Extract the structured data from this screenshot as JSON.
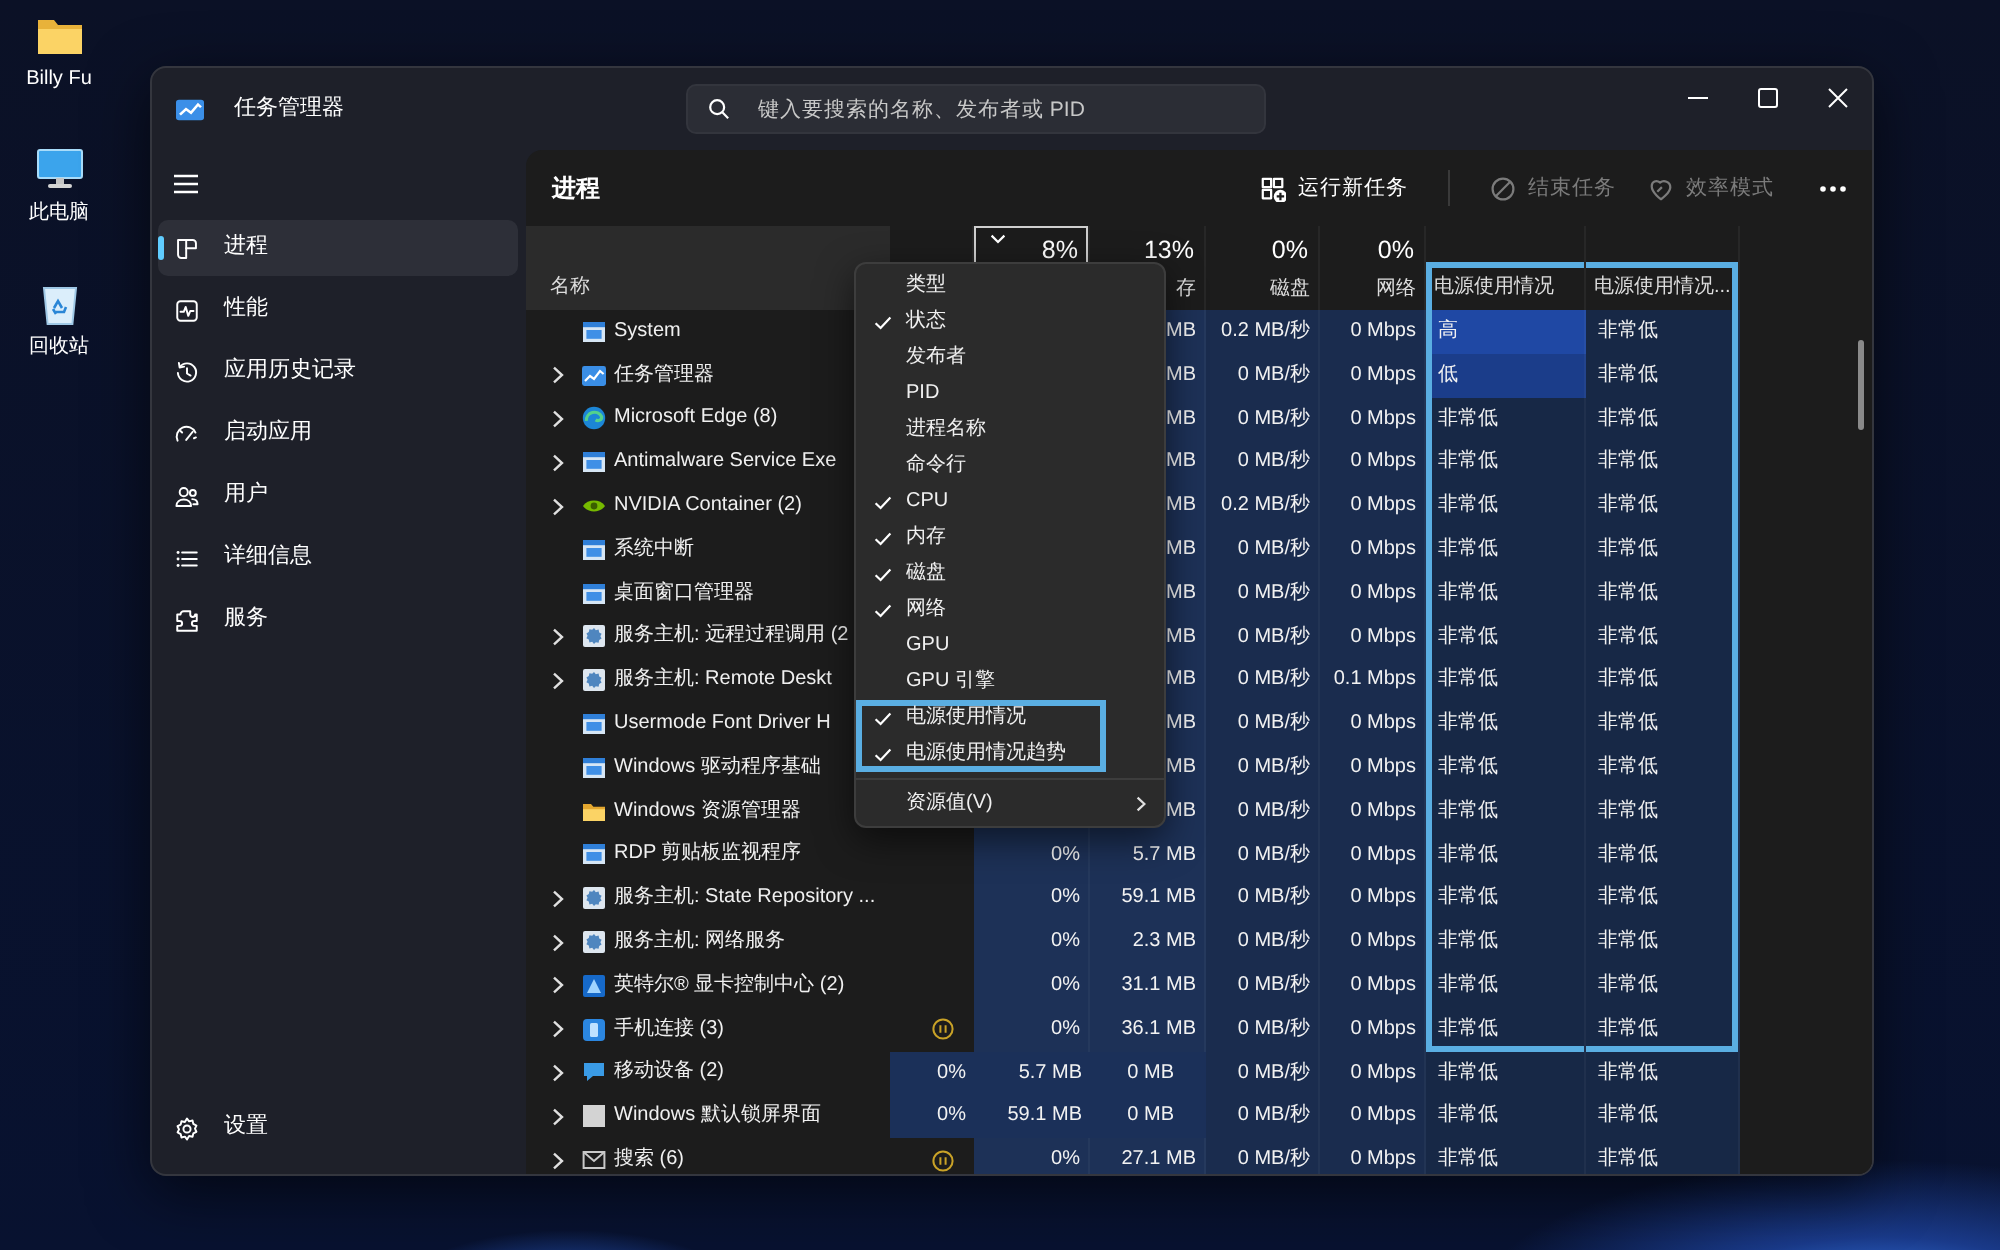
{
  "desktop": {
    "icons": [
      {
        "kind": "folder",
        "label": "Billy Fu"
      },
      {
        "kind": "computer",
        "label": "此电脑"
      },
      {
        "kind": "recycle",
        "label": "回收站"
      }
    ]
  },
  "window": {
    "title": "任务管理器",
    "search": {
      "placeholder": "键入要搜索的名称、发布者或 PID"
    }
  },
  "sidebar": {
    "items": [
      {
        "kind": "processes",
        "label": "进程",
        "selected": true
      },
      {
        "kind": "performance",
        "label": "性能",
        "selected": false
      },
      {
        "kind": "history",
        "label": "应用历史记录",
        "selected": false
      },
      {
        "kind": "startup",
        "label": "启动应用",
        "selected": false
      },
      {
        "kind": "users",
        "label": "用户",
        "selected": false
      },
      {
        "kind": "details",
        "label": "详细信息",
        "selected": false
      },
      {
        "kind": "services",
        "label": "服务",
        "selected": false
      }
    ],
    "footer": {
      "kind": "settings",
      "label": "设置",
      "selected": false
    }
  },
  "page": {
    "title": "进程",
    "actions": [
      {
        "kind": "run",
        "label": "运行新任务",
        "disabled": false
      },
      {
        "kind": "end",
        "label": "结束任务",
        "disabled": true
      },
      {
        "kind": "eco",
        "label": "效率模式",
        "disabled": true
      }
    ]
  },
  "table": {
    "columns": [
      {
        "kind": "name",
        "label": "名称"
      },
      {
        "kind": "status"
      },
      {
        "kind": "metric",
        "percent": "8%",
        "sorted": true
      },
      {
        "kind": "metric",
        "percent": "13%",
        "label": "存",
        "sorted": false
      },
      {
        "kind": "metric",
        "percent": "0%",
        "label": "磁盘",
        "sorted": false
      },
      {
        "kind": "metric",
        "percent": "0%",
        "label": "网络",
        "sorted": false
      },
      {
        "kind": "text",
        "label": "电源使用情况",
        "framed": true
      },
      {
        "kind": "text",
        "label": "电源使用情况...",
        "framed": true
      }
    ],
    "rows": [
      {
        "name": "System",
        "kind": "window",
        "expandable": false,
        "memory": "MB",
        "disk": "0.2 MB/秒",
        "network": "0 Mbps",
        "power": "高",
        "color": "#1f48a4",
        "trend": "非常低",
        "framed": true
      },
      {
        "name": "任务管理器",
        "kind": "taskmgr",
        "expandable": true,
        "memory": "MB",
        "disk": "0 MB/秒",
        "network": "0 Mbps",
        "power": "低",
        "color": "#1b3d8a",
        "trend": "非常低",
        "framed": true
      },
      {
        "name": "Microsoft Edge (8)",
        "kind": "edge",
        "expandable": true,
        "memory": "MB",
        "disk": "0 MB/秒",
        "network": "0 Mbps",
        "power": "非常低",
        "color": "#172846",
        "trend": "非常低",
        "framed": true
      },
      {
        "name": "Antimalware Service Exe",
        "kind": "window",
        "expandable": true,
        "memory": "MB",
        "disk": "0 MB/秒",
        "network": "0 Mbps",
        "power": "非常低",
        "color": "#172846",
        "trend": "非常低",
        "framed": true
      },
      {
        "name": "NVIDIA Container (2)",
        "kind": "nvidia",
        "expandable": true,
        "memory": "MB",
        "disk": "0.2 MB/秒",
        "network": "0 Mbps",
        "power": "非常低",
        "color": "#172846",
        "trend": "非常低",
        "framed": true
      },
      {
        "name": "系统中断",
        "kind": "window",
        "expandable": false,
        "memory": "MB",
        "disk": "0 MB/秒",
        "network": "0 Mbps",
        "power": "非常低",
        "color": "#172846",
        "trend": "非常低",
        "framed": true
      },
      {
        "name": "桌面窗口管理器",
        "kind": "window",
        "expandable": false,
        "memory": "MB",
        "disk": "0 MB/秒",
        "network": "0 Mbps",
        "power": "非常低",
        "color": "#172846",
        "trend": "非常低",
        "framed": true
      },
      {
        "name": "服务主机: 远程过程调用 (2",
        "kind": "service",
        "expandable": true,
        "memory": "MB",
        "disk": "0 MB/秒",
        "network": "0 Mbps",
        "power": "非常低",
        "color": "#172846",
        "trend": "非常低",
        "framed": true
      },
      {
        "name": "服务主机: Remote Deskt",
        "kind": "service",
        "expandable": true,
        "memory": "MB",
        "disk": "0 MB/秒",
        "network": "0.1 Mbps",
        "power": "非常低",
        "color": "#172846",
        "trend": "非常低",
        "framed": true
      },
      {
        "name": "Usermode Font Driver H",
        "kind": "window",
        "expandable": false,
        "memory": "MB",
        "disk": "0 MB/秒",
        "network": "0 Mbps",
        "power": "非常低",
        "color": "#172846",
        "trend": "非常低",
        "framed": true
      },
      {
        "name": "Windows 驱动程序基础",
        "kind": "window",
        "expandable": false,
        "memory": "MB",
        "disk": "0 MB/秒",
        "network": "0 Mbps",
        "power": "非常低",
        "color": "#172846",
        "trend": "非常低",
        "framed": true
      },
      {
        "name": "Windows 资源管理器",
        "kind": "folder",
        "expandable": false,
        "memory": "MB",
        "disk": "0 MB/秒",
        "network": "0 Mbps",
        "power": "非常低",
        "color": "#172846",
        "trend": "非常低",
        "framed": true
      },
      {
        "name": "RDP 剪贴板监视程序",
        "kind": "window",
        "expandable": false,
        "suspended": false,
        "cpu": "0%",
        "memory": "5.7 MB",
        "disk": "0 MB/秒",
        "network": "0 Mbps",
        "power": "非常低",
        "color": "#172846",
        "trend": "非常低",
        "framed": true
      },
      {
        "name": "服务主机: State Repository ...",
        "kind": "service",
        "expandable": true,
        "suspended": false,
        "cpu": "0%",
        "memory": "59.1 MB",
        "disk": "0 MB/秒",
        "network": "0 Mbps",
        "power": "非常低",
        "color": "#172846",
        "trend": "非常低",
        "framed": true
      },
      {
        "name": "服务主机: 网络服务",
        "kind": "service",
        "expandable": true,
        "suspended": false,
        "cpu": "0%",
        "memory": "2.3 MB",
        "disk": "0 MB/秒",
        "network": "0 Mbps",
        "power": "非常低",
        "color": "#172846",
        "trend": "非常低",
        "framed": true
      },
      {
        "name": "英特尔® 显卡控制中心 (2)",
        "kind": "intel",
        "expandable": true,
        "suspended": false,
        "cpu": "0%",
        "memory": "31.1 MB",
        "disk": "0 MB/秒",
        "network": "0 Mbps",
        "power": "非常低",
        "color": "#172846",
        "trend": "非常低",
        "framed": true
      },
      {
        "name": "手机连接 (3)",
        "kind": "phone",
        "expandable": true,
        "suspended": true,
        "cpu": "0%",
        "memory": "36.1 MB",
        "disk": "0 MB/秒",
        "network": "0 Mbps",
        "power": "非常低",
        "color": "#172846",
        "trend": "非常低",
        "framed": true
      },
      {
        "name": "移动设备 (2)",
        "kind": "device",
        "expandable": true,
        "shifted_cells": [
          "0%",
          "5.7 MB",
          "0 MB"
        ],
        "disk": "0 MB/秒",
        "network": "0 Mbps",
        "power": "非常低",
        "color": "#172846",
        "trend": "非常低",
        "framed": false
      },
      {
        "name": "Windows 默认锁屏界面",
        "kind": "blank",
        "expandable": true,
        "shifted_cells": [
          "0%",
          "59.1 MB",
          "0 MB"
        ],
        "disk": "0 MB/秒",
        "network": "0 Mbps",
        "power": "非常低",
        "color": "#172846",
        "trend": "非常低",
        "framed": false
      },
      {
        "name": "搜索 (6)",
        "kind": "search",
        "expandable": true,
        "suspended": true,
        "cpu": "0%",
        "memory": "27.1 MB",
        "disk": "0 MB/秒",
        "network": "0 Mbps",
        "power": "非常低",
        "color": "#172846",
        "trend": "非常低",
        "framed": false
      }
    ]
  },
  "column_menu": {
    "items": [
      {
        "kind": "check",
        "label": "类型",
        "checked": false,
        "framed": false
      },
      {
        "kind": "check",
        "label": "状态",
        "checked": true,
        "framed": false
      },
      {
        "kind": "check",
        "label": "发布者",
        "checked": false,
        "framed": false
      },
      {
        "kind": "check",
        "label": "PID",
        "checked": false,
        "framed": false
      },
      {
        "kind": "check",
        "label": "进程名称",
        "checked": false,
        "framed": false
      },
      {
        "kind": "check",
        "label": "命令行",
        "checked": false,
        "framed": false
      },
      {
        "kind": "check",
        "label": "CPU",
        "checked": true,
        "framed": false
      },
      {
        "kind": "check",
        "label": "内存",
        "checked": true,
        "framed": false
      },
      {
        "kind": "check",
        "label": "磁盘",
        "checked": true,
        "framed": false
      },
      {
        "kind": "check",
        "label": "网络",
        "checked": true,
        "framed": false
      },
      {
        "kind": "check",
        "label": "GPU",
        "checked": false,
        "framed": false
      },
      {
        "kind": "check",
        "label": "GPU 引擎",
        "checked": false,
        "framed": false
      },
      {
        "kind": "check",
        "label": "电源使用情况",
        "checked": true,
        "framed": true
      },
      {
        "kind": "check",
        "label": "电源使用情况趋势",
        "checked": true,
        "framed": true
      },
      {
        "kind": "separator"
      },
      {
        "kind": "submenu",
        "label": "资源值(V)"
      }
    ]
  }
}
